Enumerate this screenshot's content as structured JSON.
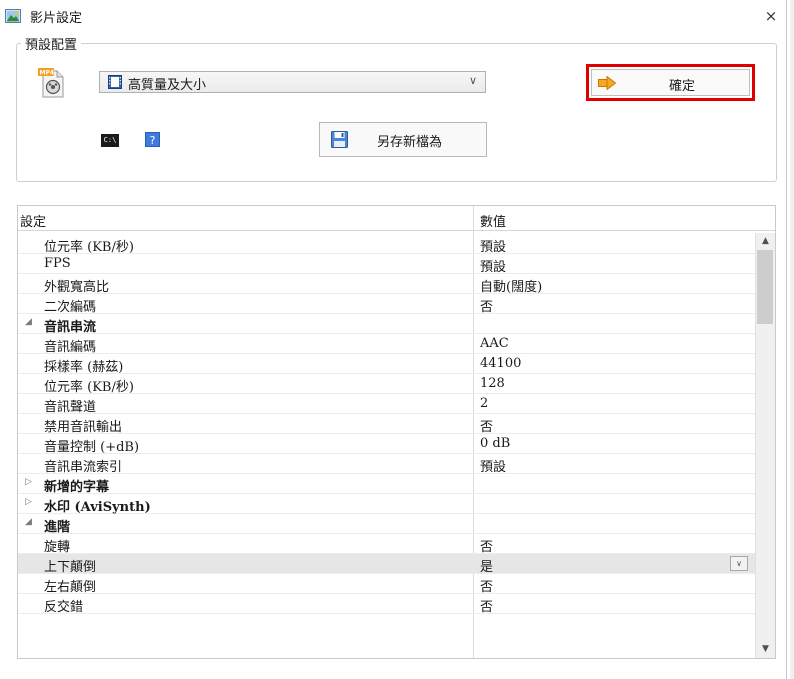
{
  "window": {
    "title": "影片設定",
    "close_glyph": "×"
  },
  "preset": {
    "legend": "預設配置",
    "selected": "高質量及大小",
    "caret": "∨",
    "ok_label": "確定",
    "saveas_label": "另存新檔為",
    "cmd_text": "C:\\",
    "help_text": "?",
    "ok_highlight_color": "#e00000"
  },
  "grid": {
    "header_setting": "設定",
    "header_value": "數值",
    "rows": [
      {
        "name": "位元率 (KB/秒)",
        "value": "預設",
        "type": "item"
      },
      {
        "name": "FPS",
        "value": "預設",
        "type": "item"
      },
      {
        "name": "外觀寬高比",
        "value": "自動(闊度)",
        "type": "item"
      },
      {
        "name": "二次編碼",
        "value": "否",
        "type": "item"
      },
      {
        "name": "音訊串流",
        "value": "",
        "type": "cat",
        "toggle": "◢"
      },
      {
        "name": "音訊編碼",
        "value": "AAC",
        "type": "item"
      },
      {
        "name": "採樣率 (赫茲)",
        "value": "44100",
        "type": "item"
      },
      {
        "name": "位元率 (KB/秒)",
        "value": "128",
        "type": "item"
      },
      {
        "name": "音訊聲道",
        "value": "2",
        "type": "item"
      },
      {
        "name": "禁用音訊輸出",
        "value": "否",
        "type": "item"
      },
      {
        "name": "音量控制 (+dB)",
        "value": "0 dB",
        "type": "item"
      },
      {
        "name": "音訊串流索引",
        "value": "預設",
        "type": "item"
      },
      {
        "name": "新增的字幕",
        "value": "",
        "type": "cat",
        "toggle": "▷"
      },
      {
        "name": "水印 (AviSynth)",
        "value": "",
        "type": "cat",
        "toggle": "▷"
      },
      {
        "name": "進階",
        "value": "",
        "type": "cat",
        "toggle": "◢"
      },
      {
        "name": "旋轉",
        "value": "否",
        "type": "item"
      },
      {
        "name": "上下顛倒",
        "value": "是",
        "type": "item",
        "selected": true,
        "dropdown": "∨"
      },
      {
        "name": "左右顛倒",
        "value": "否",
        "type": "item"
      },
      {
        "name": "反交錯",
        "value": "否",
        "type": "item"
      }
    ],
    "scroll_up": "▲",
    "scroll_down": "▼"
  },
  "icons": {
    "app": "app-image-icon",
    "mp4": "mp4-file-icon",
    "preset": "film-icon",
    "ok": "arrow-right-icon",
    "save": "floppy-disk-icon",
    "cmd": "command-prompt-icon",
    "help": "help-icon"
  }
}
